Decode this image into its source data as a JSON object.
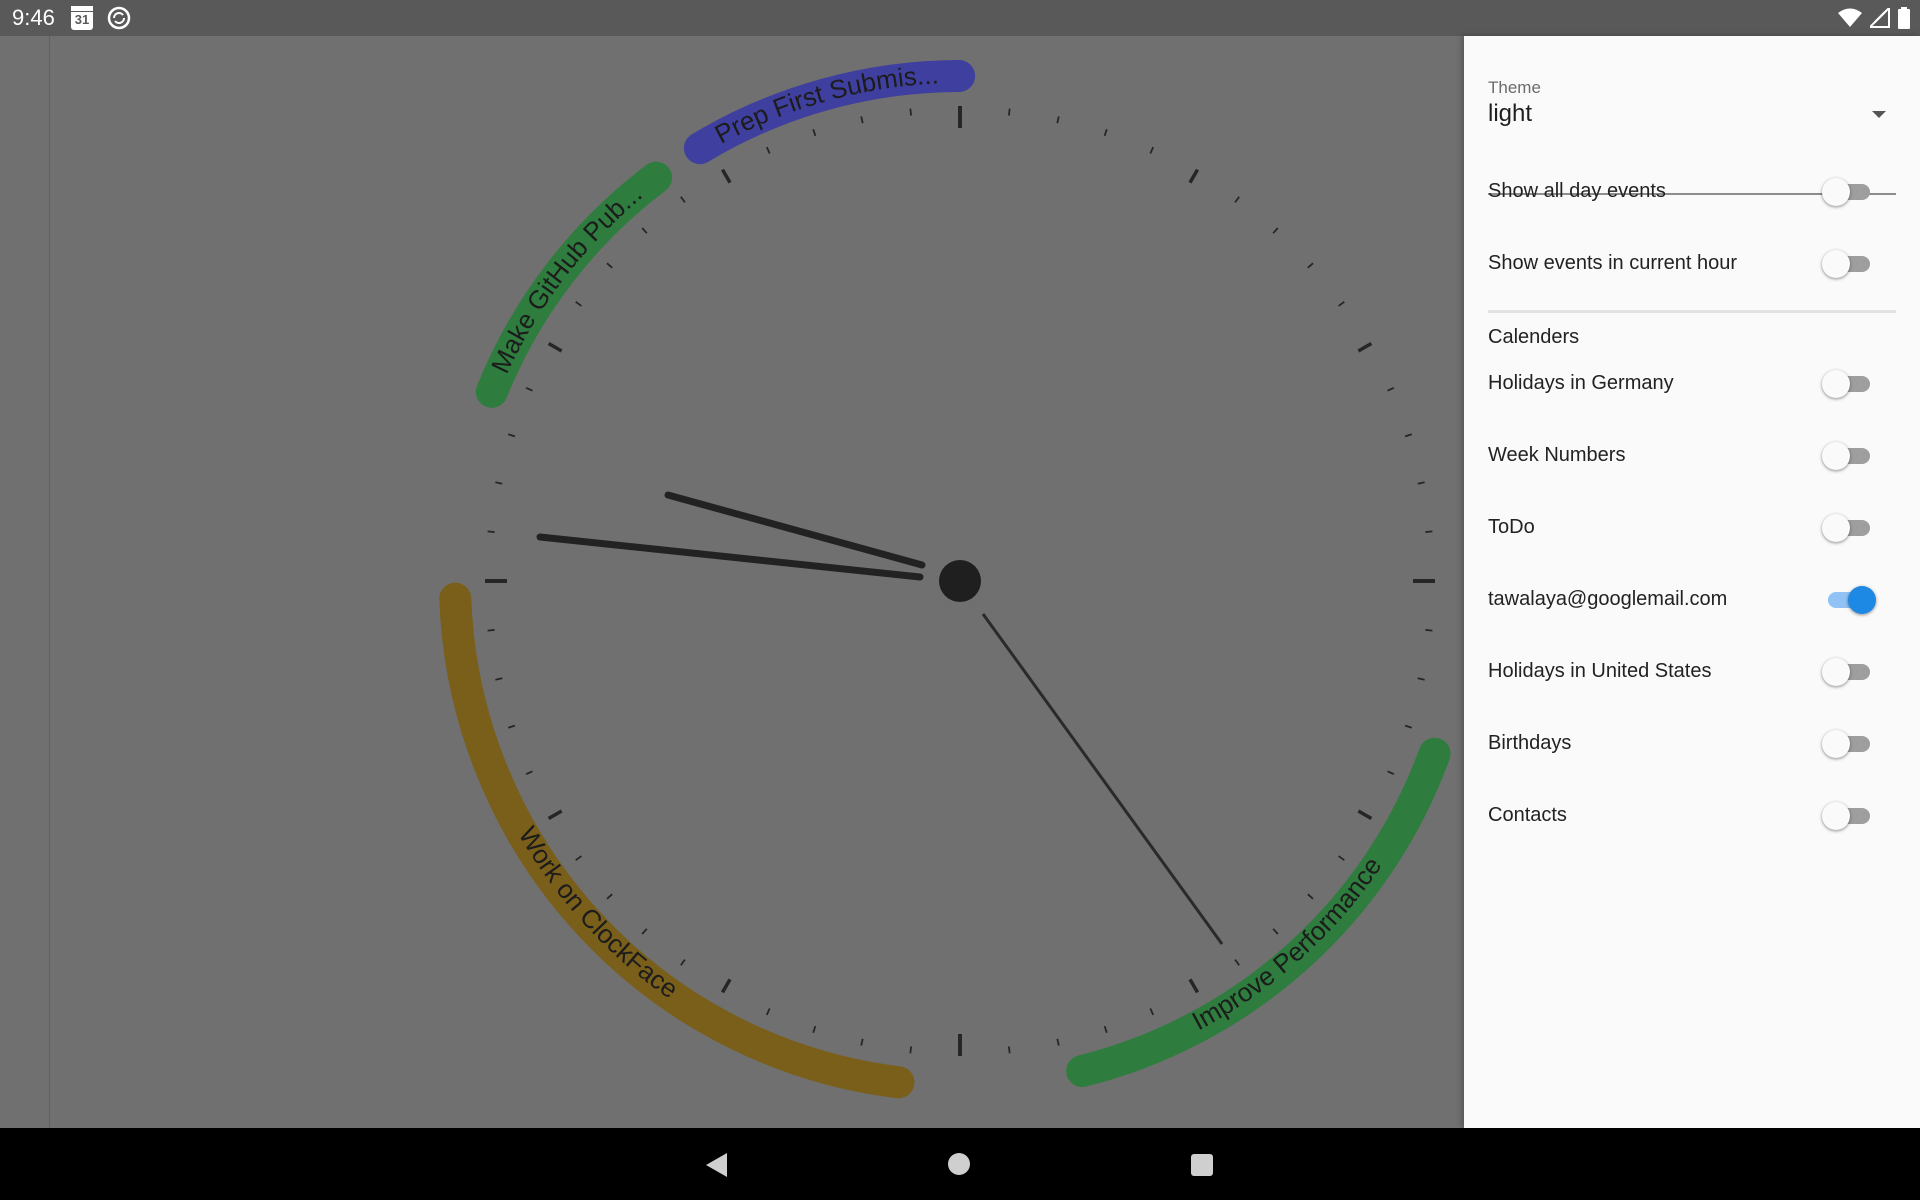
{
  "status_bar": {
    "time": "9:46",
    "calendar_icon_text": "31",
    "icons": [
      "calendar-icon",
      "sync-icon",
      "wifi-icon",
      "signal-icon",
      "battery-icon"
    ]
  },
  "clock": {
    "events": [
      {
        "label": "Prep First Submis...",
        "color": "#3f3fa0"
      },
      {
        "label": "Make GitHub Pub...",
        "color": "#2e7d3e"
      },
      {
        "label": "Work on ClockFace",
        "color": "#7a5f1a"
      },
      {
        "label": "Improve Performance",
        "color": "#2e7d3e"
      }
    ]
  },
  "settings": {
    "theme_label": "Theme",
    "theme_value": "light",
    "show_all_day_events": {
      "label": "Show all day events",
      "on": false
    },
    "show_current_hour": {
      "label": "Show events in current hour",
      "on": false
    },
    "calendars_title": "Calenders",
    "calendars": [
      {
        "label": "Holidays in Germany",
        "on": false
      },
      {
        "label": "Week Numbers",
        "on": false
      },
      {
        "label": "ToDo",
        "on": false
      },
      {
        "label": "tawalaya@googlemail.com",
        "on": true
      },
      {
        "label": "Holidays in United States",
        "on": false
      },
      {
        "label": "Birthdays",
        "on": false
      },
      {
        "label": "Contacts",
        "on": false
      }
    ],
    "accent_color": "#1e88e5"
  },
  "nav_bar": {
    "icons": [
      "back-icon",
      "home-icon",
      "recents-icon"
    ]
  }
}
